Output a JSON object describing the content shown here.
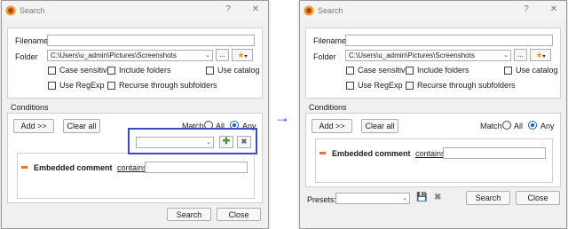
{
  "left": {
    "title": "Search",
    "help_label": "?",
    "close_label": "✕",
    "filename_label": "Filename",
    "filename_value": "",
    "folder_label": "Folder",
    "folder_value": "C:\\Users\\u_admin\\Pictures\\Screenshots",
    "browse_label": "...",
    "options": [
      "Case sensitive",
      "Include folders",
      "Use catalog",
      "Use RegExp",
      "Recurse through subfolders"
    ],
    "conditions_label": "Conditions",
    "add_label": "Add >>",
    "clear_label": "Clear all",
    "match_label": "Match",
    "match_all": "All",
    "match_any": "Any",
    "condition_title": "Embedded comment",
    "condition_op": "contains",
    "search_label": "Search",
    "close_button_label": "Close"
  },
  "right": {
    "title": "Search",
    "help_label": "?",
    "close_label": "✕",
    "filename_label": "Filename",
    "folder_label": "Folder",
    "folder_value": "C:\\Users\\u_admin\\Pictures\\Screenshots",
    "browse_label": "...",
    "options": [
      "Case sensitive",
      "Include folders",
      "Use catalog",
      "Use RegExp",
      "Recurse through subfolders"
    ],
    "conditions_label": "Conditions",
    "add_label": "Add >>",
    "clear_label": "Clear all",
    "match_label": "Match",
    "match_all": "All",
    "match_any": "Any",
    "condition_title": "Embedded comment",
    "condition_op": "contains",
    "presets_label": "Presets:",
    "search_label": "Search",
    "close_button_label": "Close"
  },
  "arrow": "→",
  "colors": {
    "highlight": "#3f49c6",
    "radio_selected": "#1a5fb4",
    "add_green": "#3c9a2a"
  }
}
